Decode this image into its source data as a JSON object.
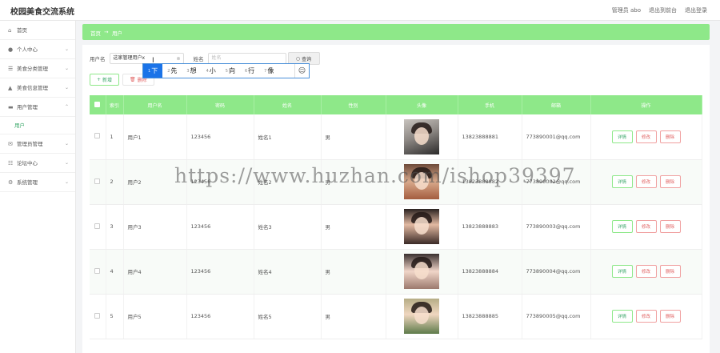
{
  "app": {
    "title": "校园美食交流系统"
  },
  "header": {
    "user_label": "管理员 abo",
    "to_front_label": "退出到前台",
    "logout_label": "退出登录"
  },
  "sidebar": {
    "items": [
      {
        "label": "首页",
        "icon": "home-icon"
      },
      {
        "label": "个人中心",
        "icon": "user-icon"
      },
      {
        "label": "美食分类管理",
        "icon": "list-icon"
      },
      {
        "label": "美食信息管理",
        "icon": "food-icon"
      },
      {
        "label": "用户管理",
        "icon": "users-icon"
      },
      {
        "label": "管理员管理",
        "icon": "admin-icon"
      },
      {
        "label": "论坛中心",
        "icon": "forum-icon"
      },
      {
        "label": "系统管理",
        "icon": "gear-icon"
      }
    ],
    "sub_item": "用户"
  },
  "breadcrumb": {
    "home": "首页",
    "separator": "→",
    "current": "用户"
  },
  "search": {
    "username_label": "用户名",
    "username_value": "这家管理用户x",
    "name_label": "姓名",
    "name_placeholder": "姓名",
    "search_button": "查询"
  },
  "ime": {
    "candidates": [
      {
        "num": "1",
        "text": "下"
      },
      {
        "num": "2",
        "text": "先"
      },
      {
        "num": "3",
        "text": "想"
      },
      {
        "num": "4",
        "text": "小"
      },
      {
        "num": "5",
        "text": "向"
      },
      {
        "num": "6",
        "text": "行"
      },
      {
        "num": "7",
        "text": "像"
      }
    ],
    "emoji": "☺"
  },
  "actions": {
    "add_label": "新增",
    "delete_label": "删除"
  },
  "table": {
    "columns": [
      "索引",
      "用户名",
      "密码",
      "姓名",
      "性别",
      "头像",
      "手机",
      "邮箱",
      "操作"
    ],
    "rows": [
      {
        "index": "1",
        "username": "用户1",
        "password": "123456",
        "name": "姓名1",
        "gender": "男",
        "phone": "13823888881",
        "email": "773890001@qq.com"
      },
      {
        "index": "2",
        "username": "用户2",
        "password": "123456",
        "name": "姓名2",
        "gender": "男",
        "phone": "13823888882",
        "email": "773890002@qq.com"
      },
      {
        "index": "3",
        "username": "用户3",
        "password": "123456",
        "name": "姓名3",
        "gender": "男",
        "phone": "13823888883",
        "email": "773890003@qq.com"
      },
      {
        "index": "4",
        "username": "用户4",
        "password": "123456",
        "name": "姓名4",
        "gender": "男",
        "phone": "13823888884",
        "email": "773890004@qq.com"
      },
      {
        "index": "5",
        "username": "用户5",
        "password": "123456",
        "name": "姓名5",
        "gender": "男",
        "phone": "13823888885",
        "email": "773890005@qq.com"
      }
    ],
    "op_detail": "详情",
    "op_edit": "修改",
    "op_delete": "删除"
  },
  "watermark": "https://www.huzhan.com/ishop39397",
  "colors": {
    "accent": "#8ee889",
    "accent_text": "#3ca86b",
    "danger": "#e06060"
  }
}
